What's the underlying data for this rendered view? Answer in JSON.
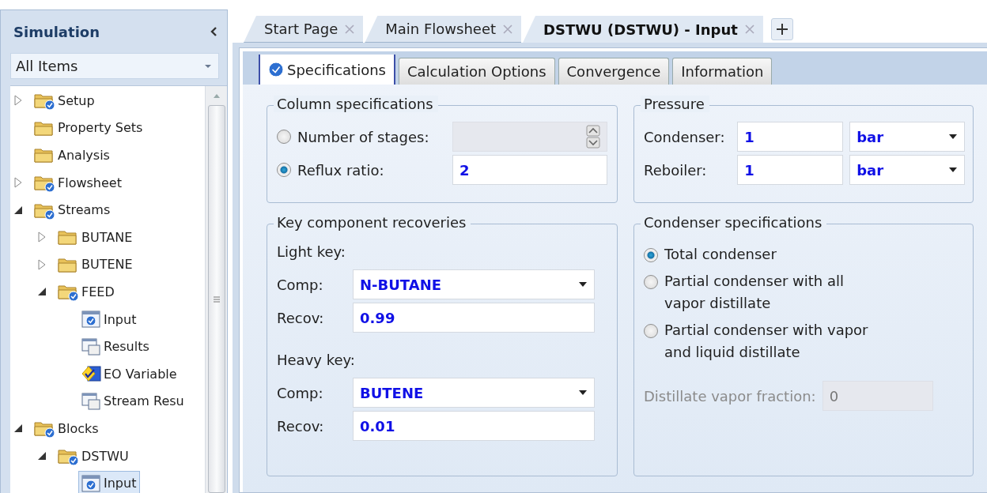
{
  "sidebar": {
    "title": "Simulation",
    "filter": "All Items",
    "tree": [
      {
        "label": "Setup",
        "kind": "folder-check",
        "expanded": false,
        "selected": false
      },
      {
        "label": "Property Sets",
        "kind": "folder",
        "selected": false
      },
      {
        "label": "Analysis",
        "kind": "folder",
        "selected": false
      },
      {
        "label": "Flowsheet",
        "kind": "folder-check",
        "expanded": false,
        "selected": false
      },
      {
        "label": "Streams",
        "kind": "folder-check",
        "expanded": true,
        "selected": false,
        "children": [
          {
            "label": "BUTANE",
            "kind": "folder",
            "expanded": false,
            "selected": false
          },
          {
            "label": "BUTENE",
            "kind": "folder",
            "expanded": false,
            "selected": false
          },
          {
            "label": "FEED",
            "kind": "folder-check",
            "expanded": true,
            "selected": false,
            "children": [
              {
                "label": "Input",
                "kind": "form",
                "selected": false
              },
              {
                "label": "Results",
                "kind": "results",
                "selected": false
              },
              {
                "label": "EO Variable",
                "kind": "variables",
                "selected": false
              },
              {
                "label": "Stream Resu",
                "kind": "results",
                "selected": false
              }
            ]
          }
        ]
      },
      {
        "label": "Blocks",
        "kind": "folder-check",
        "expanded": true,
        "selected": false,
        "children": [
          {
            "label": "DSTWU",
            "kind": "folder-check",
            "expanded": true,
            "selected": false,
            "children": [
              {
                "label": "Input",
                "kind": "form",
                "selected": true
              }
            ]
          }
        ]
      }
    ]
  },
  "doc_tabs": [
    {
      "label": "Start Page",
      "selected": false
    },
    {
      "label": "Main Flowsheet",
      "selected": false
    },
    {
      "label": "DSTWU (DSTWU) - Input",
      "selected": true
    }
  ],
  "form_tabs": [
    {
      "label": "Specifications",
      "selected": true,
      "complete": true
    },
    {
      "label": "Calculation Options",
      "selected": false,
      "complete": false
    },
    {
      "label": "Convergence",
      "selected": false,
      "complete": false
    },
    {
      "label": "Information",
      "selected": false,
      "complete": false
    }
  ],
  "column_specifications": {
    "title": "Column specifications",
    "options": [
      {
        "label": "Number of stages:",
        "selected": false,
        "kind": "spin"
      },
      {
        "label": "Reflux ratio:",
        "selected": true,
        "kind": "text",
        "value": "2"
      }
    ]
  },
  "pressure": {
    "title": "Pressure",
    "rows": [
      {
        "label": "Condenser:",
        "value": "1",
        "unit": "bar"
      },
      {
        "label": "Reboiler:",
        "value": "1",
        "unit": "bar"
      }
    ]
  },
  "key_component_recoveries": {
    "title": "Key component recoveries",
    "keys": [
      {
        "heading": "Light key:",
        "comp_label": "Comp:",
        "comp": "N-BUTANE",
        "recov_label": "Recov:",
        "recov": "0.99"
      },
      {
        "heading": "Heavy key:",
        "comp_label": "Comp:",
        "comp": "BUTENE",
        "recov_label": "Recov:",
        "recov": "0.01"
      }
    ]
  },
  "condenser_specifications": {
    "title": "Condenser specifications",
    "options": [
      {
        "label": "Total condenser",
        "selected": true
      },
      {
        "label": "Partial condenser with all\nvapor distillate",
        "selected": false
      },
      {
        "label": "Partial condenser with vapor\nand liquid distillate",
        "selected": false
      }
    ],
    "fraction": {
      "label": "Distillate vapor fraction:",
      "value": "0",
      "disabled": true
    }
  }
}
